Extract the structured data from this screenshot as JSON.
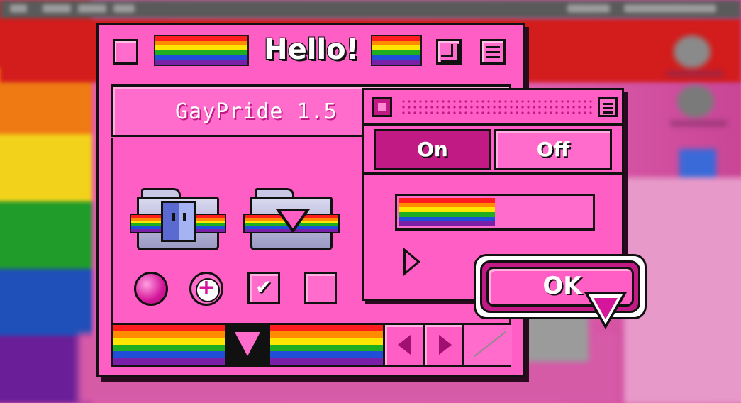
{
  "colors": {
    "window_pink": "#ff5ec4",
    "accent_magenta": "#c21a84",
    "rainbow": [
      "#ff1e1e",
      "#ff8c00",
      "#ffe600",
      "#1fae1f",
      "#1f4fd8",
      "#7a1fa8"
    ]
  },
  "main_window": {
    "title": "Hello!",
    "header_label": "GayPride 1.5",
    "icons": [
      "finder-folder-icon",
      "triangle-folder-icon"
    ],
    "controls": [
      "radio-filled",
      "radio-plus",
      "checkbox-checked",
      "checkbox-empty"
    ]
  },
  "small_window": {
    "on_label": "On",
    "off_label": "Off",
    "progress": 0.5
  },
  "ok_button": {
    "label": "OK"
  }
}
